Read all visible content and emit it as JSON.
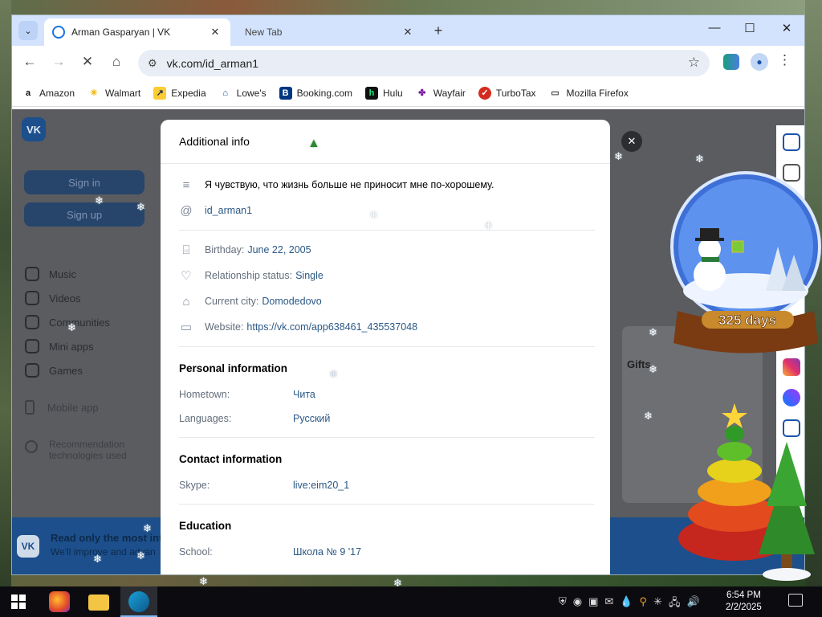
{
  "browser": {
    "tabs": [
      {
        "title": "Arman Gasparyan | VK",
        "active": true
      },
      {
        "title": "New Tab",
        "active": false
      }
    ],
    "url": "vk.com/id_arman1",
    "bookmarks": [
      {
        "label": "Amazon",
        "icon": "amazon-icon"
      },
      {
        "label": "Walmart",
        "icon": "walmart-icon"
      },
      {
        "label": "Expedia",
        "icon": "expedia-icon"
      },
      {
        "label": "Lowe's",
        "icon": "lowes-icon"
      },
      {
        "label": "Booking.com",
        "icon": "booking-icon"
      },
      {
        "label": "Hulu",
        "icon": "hulu-icon"
      },
      {
        "label": "Wayfair",
        "icon": "wayfair-icon"
      },
      {
        "label": "TurboTax",
        "icon": "turbotax-icon"
      },
      {
        "label": "Mozilla Firefox",
        "icon": "folder-icon"
      }
    ]
  },
  "vk": {
    "sign_in": "Sign in",
    "sign_up": "Sign up",
    "nav": [
      {
        "label": "Music"
      },
      {
        "label": "Videos"
      },
      {
        "label": "Communities"
      },
      {
        "label": "Mini apps"
      },
      {
        "label": "Games"
      }
    ],
    "mobile_app": "Mobile app",
    "recommendation": [
      "Recommendation",
      "technologies used"
    ],
    "gifts": "Gifts",
    "banner_title": "Read only the most inte",
    "banner_sub": "We'll improve and advan"
  },
  "modal": {
    "title": "Additional info",
    "status": "Я чувствую, что жизнь больше не приносит мне по-хорошему.",
    "username": "id_arman1",
    "birthday_label": "Birthday:",
    "birthday": "June 22, 2005",
    "relationship_label": "Relationship status:",
    "relationship": "Single",
    "city_label": "Current city:",
    "city": "Domodedovo",
    "website_label": "Website:",
    "website": "https://vk.com/app638461_435537048",
    "personal": {
      "heading": "Personal information",
      "hometown_label": "Hometown:",
      "hometown": "Чита",
      "languages_label": "Languages:",
      "languages": "Русский"
    },
    "contact": {
      "heading": "Contact information",
      "skype_label": "Skype:",
      "skype": "live:eim20_1"
    },
    "education": {
      "heading": "Education",
      "school_label": "School:",
      "school": "Школа № 9 '17"
    }
  },
  "widget": {
    "countdown": "325 days"
  },
  "taskbar": {
    "time": "6:54 PM",
    "date": "2/2/2025"
  }
}
